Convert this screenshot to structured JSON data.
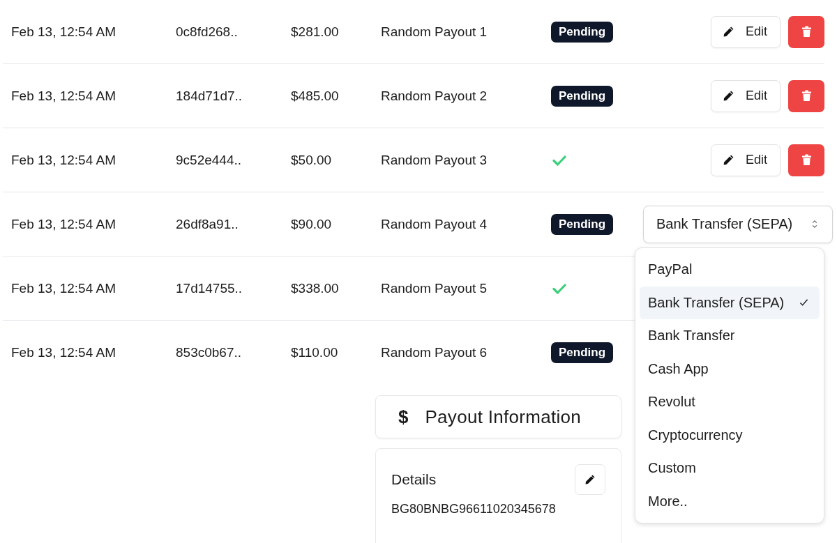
{
  "rows": [
    {
      "date": "Feb 13, 12:54 AM",
      "id": "0c8fd268..",
      "amount": "$281.00",
      "name": "Random Payout 1",
      "status": {
        "kind": "pending",
        "label": "Pending"
      },
      "actions": {
        "kind": "buttons",
        "edit": "Edit"
      }
    },
    {
      "date": "Feb 13, 12:54 AM",
      "id": "184d71d7..",
      "amount": "$485.00",
      "name": "Random Payout 2",
      "status": {
        "kind": "pending",
        "label": "Pending"
      },
      "actions": {
        "kind": "buttons",
        "edit": "Edit"
      }
    },
    {
      "date": "Feb 13, 12:54 AM",
      "id": "9c52e444..",
      "amount": "$50.00",
      "name": "Random Payout 3",
      "status": {
        "kind": "done"
      },
      "actions": {
        "kind": "buttons",
        "edit": "Edit"
      }
    },
    {
      "date": "Feb 13, 12:54 AM",
      "id": "26df8a91..",
      "amount": "$90.00",
      "name": "Random Payout 4",
      "status": {
        "kind": "pending",
        "label": "Pending"
      },
      "actions": {
        "kind": "select",
        "value": "Bank Transfer (SEPA)",
        "expanded": true
      }
    },
    {
      "date": "Feb 13, 12:54 AM",
      "id": "17d14755..",
      "amount": "$338.00",
      "name": "Random Payout 5",
      "status": {
        "kind": "done"
      }
    },
    {
      "date": "Feb 13, 12:54 AM",
      "id": "853c0b67..",
      "amount": "$110.00",
      "name": "Random Payout 6",
      "status": {
        "kind": "pending",
        "label": "Pending"
      }
    }
  ],
  "dropdown_options": [
    {
      "label": "PayPal",
      "selected": false
    },
    {
      "label": "Bank Transfer (SEPA)",
      "selected": true
    },
    {
      "label": "Bank Transfer",
      "selected": false
    },
    {
      "label": "Cash App",
      "selected": false
    },
    {
      "label": "Revolut",
      "selected": false
    },
    {
      "label": "Cryptocurrency",
      "selected": false
    },
    {
      "label": "Custom",
      "selected": false
    },
    {
      "label": "More..",
      "selected": false
    }
  ],
  "payout_info": {
    "symbol": "$",
    "title": "Payout Information"
  },
  "details": {
    "title": "Details",
    "value": "BG80BNBG96611020345678"
  }
}
